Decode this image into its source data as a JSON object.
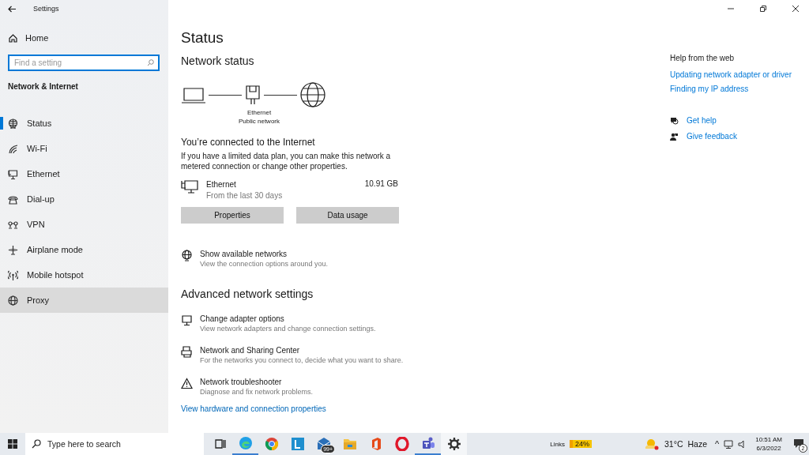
{
  "window": {
    "title": "Settings"
  },
  "sidebar": {
    "home": "Home",
    "search": {
      "placeholder": "Find a setting"
    },
    "section": "Network & Internet",
    "items": [
      {
        "label": "Status",
        "selected": true,
        "hovered": false
      },
      {
        "label": "Wi-Fi",
        "selected": false,
        "hovered": false
      },
      {
        "label": "Ethernet",
        "selected": false,
        "hovered": false
      },
      {
        "label": "Dial-up",
        "selected": false,
        "hovered": false
      },
      {
        "label": "VPN",
        "selected": false,
        "hovered": false
      },
      {
        "label": "Airplane mode",
        "selected": false,
        "hovered": false
      },
      {
        "label": "Mobile hotspot",
        "selected": false,
        "hovered": false
      },
      {
        "label": "Proxy",
        "selected": false,
        "hovered": true
      }
    ]
  },
  "page": {
    "title": "Status",
    "network_status": {
      "heading": "Network status",
      "adapter": "Ethernet",
      "network": "Public network"
    },
    "connection": {
      "heading": "You’re connected to the Internet",
      "text": "If you have a limited data plan, you can make this network a metered connection or change other properties.",
      "usage": {
        "name": "Ethernet",
        "period": "From the last 30 days",
        "amount": "10.91 GB"
      },
      "buttons": [
        "Properties",
        "Data usage"
      ]
    },
    "show_networks": {
      "title": "Show available networks",
      "subtitle": "View the connection options around you."
    },
    "advanced": {
      "heading": "Advanced network settings",
      "items": [
        {
          "title": "Change adapter options",
          "subtitle": "View network adapters and change connection settings."
        },
        {
          "title": "Network and Sharing Center",
          "subtitle": "For the networks you connect to, decide what you want to share."
        },
        {
          "title": "Network troubleshooter",
          "subtitle": "Diagnose and fix network problems."
        }
      ],
      "link": "View hardware and connection properties"
    }
  },
  "help": {
    "heading": "Help from the web",
    "links": [
      "Updating network adapter or driver",
      "Finding my IP address"
    ],
    "actions": [
      "Get help",
      "Give feedback"
    ]
  },
  "taskbar": {
    "search": {
      "placeholder": "Type here to search"
    },
    "apps": [
      {
        "running": true,
        "active": false
      },
      {
        "running": false,
        "active": false
      },
      {
        "running": false,
        "active": false
      },
      {
        "running": false,
        "active": false,
        "badge": "99+"
      },
      {
        "running": false,
        "active": false
      },
      {
        "running": false,
        "active": false
      },
      {
        "running": false,
        "active": false
      },
      {
        "running": true,
        "active": false
      },
      {
        "running": false,
        "active": true
      }
    ],
    "tray": {
      "links": "Links",
      "meter": "24%",
      "temperature": "31°C",
      "weather": "Haze",
      "caret": "^",
      "time": "10:51 AM",
      "date": "6/3/2022",
      "notifications": "2"
    }
  }
}
